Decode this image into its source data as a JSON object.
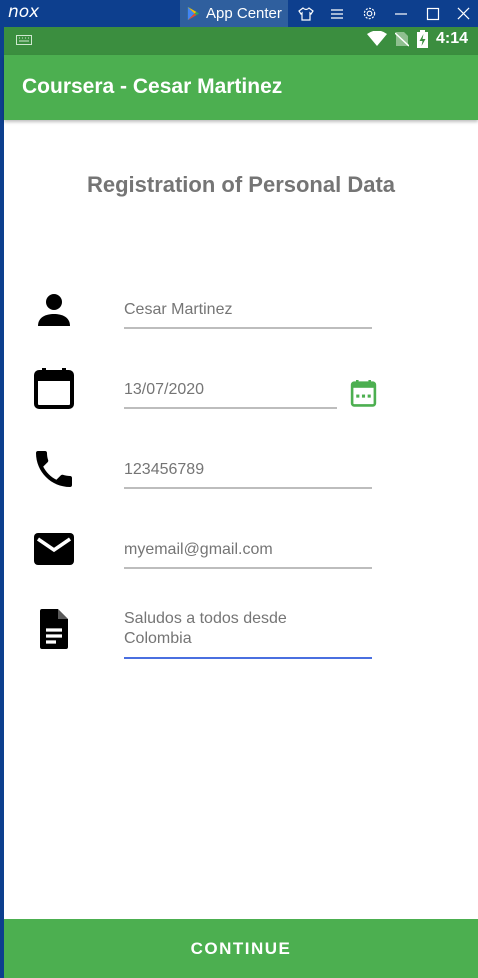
{
  "emulator": {
    "logo": "nox",
    "app_center_label": "App Center",
    "controls": [
      "shirt-icon",
      "menu-icon",
      "gear-icon",
      "minimize-icon",
      "maximize-icon",
      "close-icon"
    ]
  },
  "status_bar": {
    "time": "4:14",
    "icons": [
      "keyboard-icon",
      "wifi-icon",
      "no-sim-icon",
      "battery-charging-icon"
    ]
  },
  "app_bar": {
    "title": "Coursera - Cesar Martinez"
  },
  "form": {
    "title": "Registration of Personal Data",
    "name": {
      "value": "Cesar Martinez",
      "icon": "person-icon"
    },
    "date": {
      "value": "13/07/2020",
      "icon": "calendar-icon",
      "picker_icon": "calendar-picker-icon"
    },
    "phone": {
      "value": "123456789",
      "icon": "phone-icon"
    },
    "email": {
      "value": "myemail@gmail.com",
      "icon": "email-icon"
    },
    "description": {
      "value": "Saludos a todos desde\nColombia",
      "line1": "Saludos a todos desde",
      "line2": "Colombia",
      "icon": "document-icon"
    }
  },
  "continue_label": "CONTINUE",
  "colors": {
    "primary": "#4caf50",
    "primary_dark": "#3b8e3f",
    "emulator_bar": "#0d3f8e",
    "focus_underline": "#4a6fe0",
    "text_gray": "#757575"
  }
}
